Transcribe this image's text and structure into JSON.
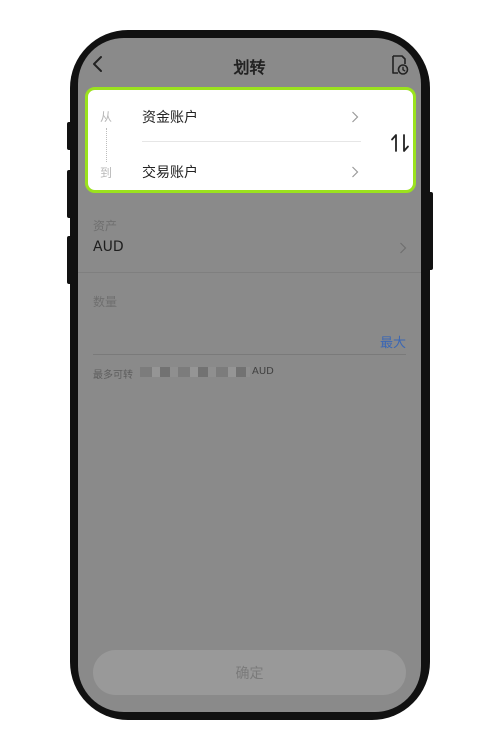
{
  "header": {
    "title": "划转",
    "back_icon": "chevron-left-icon",
    "history_icon": "record-history-icon"
  },
  "transfer": {
    "from_label": "从",
    "from_account": "资金账户",
    "to_label": "到",
    "to_account": "交易账户",
    "swap_icon": "swap-arrows-icon",
    "highlight_color": "#9be21e"
  },
  "asset": {
    "label": "资产",
    "value": "AUD"
  },
  "amount": {
    "label": "数量",
    "max_label": "最大",
    "available_prefix": "最多可转",
    "available_unit": "AUD"
  },
  "footer": {
    "confirm_label": "确定"
  },
  "colors": {
    "accent_link": "#3b67b4",
    "overlay_gray": "#8a8a8a"
  }
}
